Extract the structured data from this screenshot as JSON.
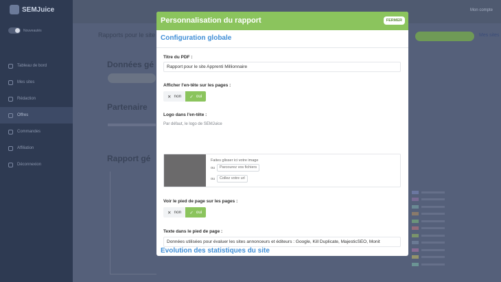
{
  "background": {
    "brand": "SEMJuice",
    "toggle_label": "Nouveautés",
    "user_menu": "Mon compte",
    "nav_items": [
      "Tableau de bord",
      "Mes sites",
      "Rédaction",
      "Offres",
      "Commandes",
      "Affiliation",
      "Déconnexion"
    ],
    "main_header": "Rapports pour le site",
    "header_link": "Mes sites",
    "sections": [
      "Données gé",
      "Partenaire",
      "Rapport gé"
    ]
  },
  "modal": {
    "title": "Personnalisation du rapport",
    "close_label": "FERMER",
    "global_section": "Configuration globale",
    "pdf_title_label": "Titre du PDF :",
    "pdf_title_value": "Rapport pour le site Apprenti Millionnaire",
    "header_toggle_label": "Afficher l'en-tête sur les pages :",
    "no_label": "non",
    "yes_label": "oui",
    "logo_label": "Logo dans l'en-tête :",
    "logo_help": "Par défaut, le logo de SEMJuice",
    "upload_drop": "Faites glisser ici votre image",
    "upload_or": "ou",
    "upload_browse": "Parcourez vos fichiers",
    "upload_url": "Collez votre url",
    "footer_toggle_label": "Voir le pied de page sur les pages :",
    "footer_text_label": "Texte dans le pied de page :",
    "footer_text_value": "Données utilisées pour évaluer les sites annonceurs et éditeurs : Google, Kill Duplicate, MajesticSEO, Monit",
    "stats_section": "Evolution des statistiques du site"
  },
  "colors": {
    "header_green": "#8bc45d",
    "section_blue": "#3f8ed6",
    "overlay_bg": "#55607a"
  }
}
